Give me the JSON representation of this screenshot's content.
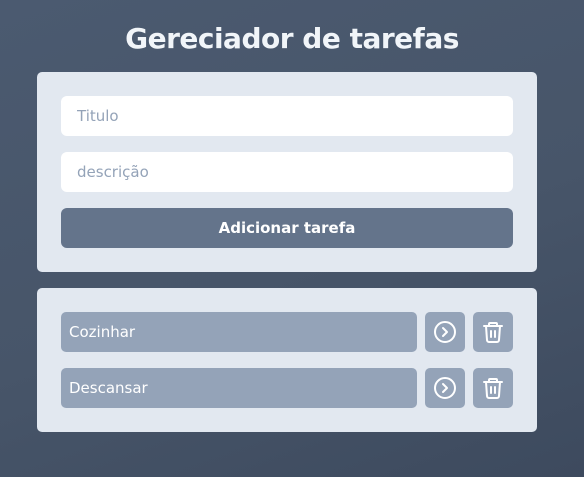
{
  "header": {
    "title": "Gereciador de tarefas"
  },
  "form": {
    "title_placeholder": "Titulo",
    "title_value": "",
    "description_placeholder": "descrição",
    "description_value": "",
    "submit_label": "Adicionar tarefa"
  },
  "tasks": [
    {
      "title": "Cozinhar",
      "action_icon": "chevron-right-circle-icon",
      "delete_icon": "trash-icon"
    },
    {
      "title": "Descansar",
      "action_icon": "chevron-right-circle-icon",
      "delete_icon": "trash-icon"
    }
  ],
  "colors": {
    "background": "#475569",
    "panel": "#e2e8f0",
    "primary_button": "#64748b",
    "task_item": "#94a3b8",
    "text_light": "#ffffff"
  }
}
